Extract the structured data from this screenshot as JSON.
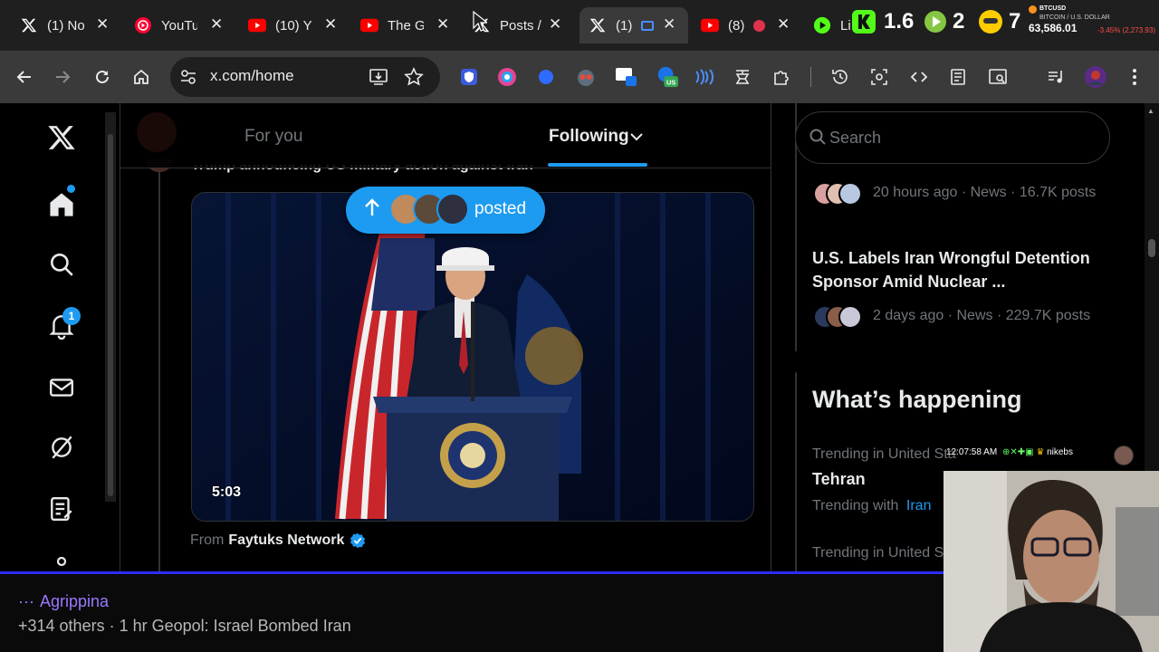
{
  "browser": {
    "tabs": [
      {
        "label": "(1) No",
        "icon": "x-icon",
        "active": false
      },
      {
        "label": "YouTu",
        "icon": "youtube-music-icon",
        "active": false
      },
      {
        "label": "(10) Y",
        "icon": "youtube-icon",
        "active": false
      },
      {
        "label": "The G",
        "icon": "youtube-icon",
        "active": false
      },
      {
        "label": "Posts /",
        "icon": "x-icon",
        "active": false
      },
      {
        "label": "(1)",
        "icon": "x-icon",
        "active": true
      },
      {
        "label": "(8)",
        "icon": "youtube-icon",
        "active": false
      },
      {
        "label": "Li",
        "icon": "play-icon",
        "active": false
      }
    ],
    "tab_close": "✕",
    "top_extensions": {
      "count_a": "1.6",
      "count_b": "2",
      "count_c": "7"
    },
    "ticker": {
      "symbol": "BTCUSD",
      "subtitle": "BITCOIN / U.S. DOLLAR",
      "price": "63,586.01",
      "change": "-3.45% (2,273.93)"
    },
    "url": "x.com/home",
    "extension_badge": "US"
  },
  "x": {
    "tabs": {
      "for_you": "For you",
      "following": "Following"
    },
    "notification_count": "1",
    "post": {
      "headline": "Trump announcing US military action against Iran",
      "posted_pill": "posted",
      "video_duration": "5:03",
      "from_prefix": "From",
      "from_name": "Faytuks Network"
    },
    "search_placeholder": "Search",
    "trends_top": [
      {
        "meta": "20 hours ago · News · 16.7K posts"
      },
      {
        "title": "U.S. Labels Iran Wrongful Detention Sponsor Amid Nuclear ...",
        "meta": "2 days ago · News · 229.7K posts"
      }
    ],
    "whats_happening": {
      "heading": "What’s happening",
      "items": [
        {
          "context": "Trending in United States",
          "title": "Tehran",
          "with_prefix": "Trending with",
          "with_link": "Iran"
        },
        {
          "context": "Trending in United States"
        }
      ]
    },
    "colors": {
      "accent": "#1d9bf0",
      "background": "#000000"
    }
  },
  "overlay": {
    "name": "Agrippina",
    "info": "+314 others · 1 hr Geopol: Israel Bombed Iran",
    "clock": "12:07:58 AM",
    "handle": "nikebs",
    "bar_color": "#2e2cff"
  }
}
